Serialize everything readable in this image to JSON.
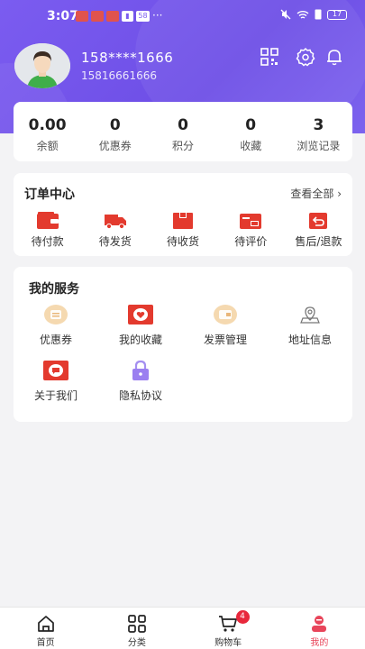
{
  "status_bar": {
    "time": "3:07",
    "battery": "17"
  },
  "profile": {
    "name": "158****1666",
    "user_id": "15816661666"
  },
  "stats": [
    {
      "value": "0.00",
      "label": "余额"
    },
    {
      "value": "0",
      "label": "优惠券"
    },
    {
      "value": "0",
      "label": "积分"
    },
    {
      "value": "0",
      "label": "收藏"
    },
    {
      "value": "3",
      "label": "浏览记录"
    }
  ],
  "orders": {
    "title": "订单中心",
    "view_all": "查看全部 ›",
    "items": [
      {
        "label": "待付款",
        "icon": "wallet-icon"
      },
      {
        "label": "待发货",
        "icon": "truck-icon"
      },
      {
        "label": "待收货",
        "icon": "box-icon"
      },
      {
        "label": "待评价",
        "icon": "review-icon"
      },
      {
        "label": "售后/退款",
        "icon": "refund-icon"
      }
    ]
  },
  "services": {
    "title": "我的服务",
    "items": [
      {
        "label": "优惠券",
        "icon": "coupon-icon"
      },
      {
        "label": "我的收藏",
        "icon": "favorite-icon"
      },
      {
        "label": "发票管理",
        "icon": "invoice-icon"
      },
      {
        "label": "地址信息",
        "icon": "location-icon"
      },
      {
        "label": "关于我们",
        "icon": "about-icon"
      },
      {
        "label": "隐私协议",
        "icon": "lock-icon"
      }
    ]
  },
  "tabbar": {
    "items": [
      {
        "label": "首页",
        "icon": "home-icon"
      },
      {
        "label": "分类",
        "icon": "category-icon"
      },
      {
        "label": "购物车",
        "icon": "cart-icon",
        "badge": "4"
      },
      {
        "label": "我的",
        "icon": "profile-icon"
      }
    ],
    "active": "我的"
  },
  "colors": {
    "header": "#7b5cf0",
    "accent_red": "#e8455a",
    "icon_red": "#e33a2e",
    "badge": "#e8283c"
  }
}
